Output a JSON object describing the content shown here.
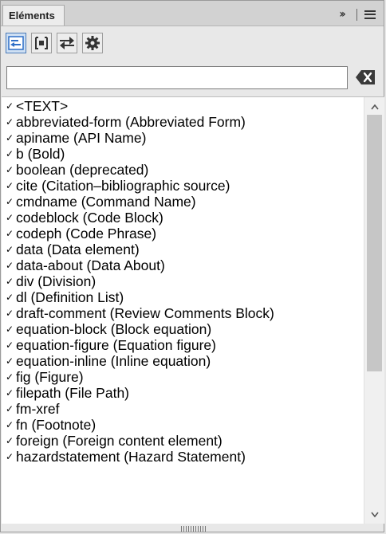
{
  "panel": {
    "tab_title": "Eléments",
    "collapse_label": "››"
  },
  "toolbar": {
    "buttons": [
      {
        "name": "insert-element-icon",
        "active": true
      },
      {
        "name": "wrap-element-icon",
        "active": false
      },
      {
        "name": "change-element-icon",
        "active": false
      },
      {
        "name": "settings-icon",
        "active": false
      }
    ]
  },
  "search": {
    "value": "",
    "placeholder": ""
  },
  "list": {
    "check_glyph": "✓",
    "items": [
      "<TEXT>",
      "abbreviated-form  (Abbreviated Form)",
      "apiname  (API Name)",
      "b  (Bold)",
      "boolean  (deprecated)",
      "cite  (Citation–bibliographic source)",
      "cmdname  (Command Name)",
      "codeblock  (Code Block)",
      "codeph  (Code Phrase)",
      "data  (Data element)",
      "data-about  (Data About)",
      "div  (Division)",
      "dl  (Definition List)",
      "draft-comment  (Review Comments Block)",
      "equation-block  (Block equation)",
      "equation-figure  (Equation figure)",
      "equation-inline  (Inline equation)",
      "fig  (Figure)",
      "filepath  (File Path)",
      "fm-xref",
      "fn  (Footnote)",
      "foreign  (Foreign content element)",
      "hazardstatement  (Hazard Statement)"
    ]
  },
  "colors": {
    "accent": "#2f6fc7",
    "selected_bg": "#cfe0f3"
  }
}
